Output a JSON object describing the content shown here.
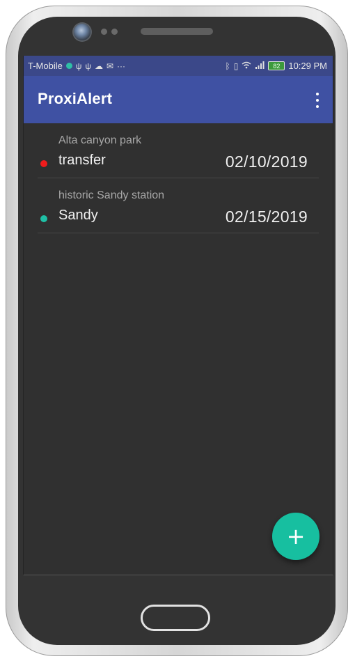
{
  "statusbar": {
    "carrier": "T-Mobile",
    "left_icons": [
      "usb-icon",
      "usb-icon",
      "cloud-icon",
      "mail-icon",
      "more-dots-icon"
    ],
    "right_icons": [
      "bluetooth-icon",
      "vibrate-icon",
      "wifi-icon",
      "signal-icon"
    ],
    "battery_level": "82",
    "time": "10:29 PM"
  },
  "appbar": {
    "title": "ProxiAlert",
    "menu_icon": "more-vert-icon"
  },
  "alerts": [
    {
      "subtitle": "Alta canyon park",
      "title": "transfer",
      "date": "02/10/2019",
      "status_color": "#f01c1c"
    },
    {
      "subtitle": "historic Sandy station",
      "title": "Sandy",
      "date": "02/15/2019",
      "status_color": "#1fc0a6"
    }
  ],
  "fab": {
    "icon": "plus-icon",
    "label": "+"
  },
  "colors": {
    "appbar": "#3f51a3",
    "statusbar": "#3b4889",
    "background": "#303030",
    "accent": "#17bfa0"
  }
}
